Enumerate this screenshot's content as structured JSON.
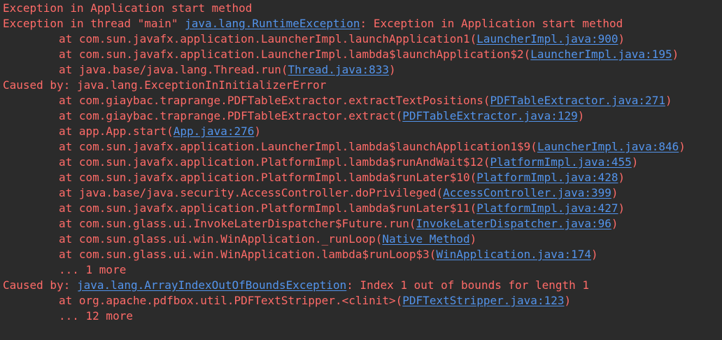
{
  "console": {
    "lines": [
      {
        "indent": false,
        "parts": [
          {
            "text": "Exception in Application start method",
            "link": false
          }
        ]
      },
      {
        "indent": false,
        "parts": [
          {
            "text": "Exception in thread \"main\" ",
            "link": false
          },
          {
            "text": "java.lang.RuntimeException",
            "link": true
          },
          {
            "text": ": Exception in Application start method",
            "link": false
          }
        ]
      },
      {
        "indent": true,
        "parts": [
          {
            "text": "at com.sun.javafx.application.LauncherImpl.launchApplication1(",
            "link": false
          },
          {
            "text": "LauncherImpl.java:900",
            "link": true
          },
          {
            "text": ")",
            "link": false
          }
        ]
      },
      {
        "indent": true,
        "parts": [
          {
            "text": "at com.sun.javafx.application.LauncherImpl.lambda$launchApplication$2(",
            "link": false
          },
          {
            "text": "LauncherImpl.java:195",
            "link": true
          },
          {
            "text": ")",
            "link": false
          }
        ]
      },
      {
        "indent": true,
        "parts": [
          {
            "text": "at java.base/java.lang.Thread.run(",
            "link": false
          },
          {
            "text": "Thread.java:833",
            "link": true
          },
          {
            "text": ")",
            "link": false
          }
        ]
      },
      {
        "indent": false,
        "parts": [
          {
            "text": "Caused by: java.lang.ExceptionInInitializerError",
            "link": false
          }
        ]
      },
      {
        "indent": true,
        "parts": [
          {
            "text": "at com.giaybac.traprange.PDFTableExtractor.extractTextPositions(",
            "link": false
          },
          {
            "text": "PDFTableExtractor.java:271",
            "link": true
          },
          {
            "text": ")",
            "link": false
          }
        ]
      },
      {
        "indent": true,
        "parts": [
          {
            "text": "at com.giaybac.traprange.PDFTableExtractor.extract(",
            "link": false
          },
          {
            "text": "PDFTableExtractor.java:129",
            "link": true
          },
          {
            "text": ")",
            "link": false
          }
        ]
      },
      {
        "indent": true,
        "parts": [
          {
            "text": "at app.App.start(",
            "link": false
          },
          {
            "text": "App.java:276",
            "link": true
          },
          {
            "text": ")",
            "link": false
          }
        ]
      },
      {
        "indent": true,
        "parts": [
          {
            "text": "at com.sun.javafx.application.LauncherImpl.lambda$launchApplication1$9(",
            "link": false
          },
          {
            "text": "LauncherImpl.java:846",
            "link": true
          },
          {
            "text": ")",
            "link": false
          }
        ]
      },
      {
        "indent": true,
        "parts": [
          {
            "text": "at com.sun.javafx.application.PlatformImpl.lambda$runAndWait$12(",
            "link": false
          },
          {
            "text": "PlatformImpl.java:455",
            "link": true
          },
          {
            "text": ")",
            "link": false
          }
        ]
      },
      {
        "indent": true,
        "parts": [
          {
            "text": "at com.sun.javafx.application.PlatformImpl.lambda$runLater$10(",
            "link": false
          },
          {
            "text": "PlatformImpl.java:428",
            "link": true
          },
          {
            "text": ")",
            "link": false
          }
        ]
      },
      {
        "indent": true,
        "parts": [
          {
            "text": "at java.base/java.security.AccessController.doPrivileged(",
            "link": false
          },
          {
            "text": "AccessController.java:399",
            "link": true
          },
          {
            "text": ")",
            "link": false
          }
        ]
      },
      {
        "indent": true,
        "parts": [
          {
            "text": "at com.sun.javafx.application.PlatformImpl.lambda$runLater$11(",
            "link": false
          },
          {
            "text": "PlatformImpl.java:427",
            "link": true
          },
          {
            "text": ")",
            "link": false
          }
        ]
      },
      {
        "indent": true,
        "parts": [
          {
            "text": "at com.sun.glass.ui.InvokeLaterDispatcher$Future.run(",
            "link": false
          },
          {
            "text": "InvokeLaterDispatcher.java:96",
            "link": true
          },
          {
            "text": ")",
            "link": false
          }
        ]
      },
      {
        "indent": true,
        "parts": [
          {
            "text": "at com.sun.glass.ui.win.WinApplication._runLoop(",
            "link": false
          },
          {
            "text": "Native Method",
            "link": true
          },
          {
            "text": ")",
            "link": false
          }
        ]
      },
      {
        "indent": true,
        "parts": [
          {
            "text": "at com.sun.glass.ui.win.WinApplication.lambda$runLoop$3(",
            "link": false
          },
          {
            "text": "WinApplication.java:174",
            "link": true
          },
          {
            "text": ")",
            "link": false
          }
        ]
      },
      {
        "indent": true,
        "parts": [
          {
            "text": "... 1 more",
            "link": false
          }
        ]
      },
      {
        "indent": false,
        "parts": [
          {
            "text": "Caused by: ",
            "link": false
          },
          {
            "text": "java.lang.ArrayIndexOutOfBoundsException",
            "link": true
          },
          {
            "text": ": Index 1 out of bounds for length 1",
            "link": false
          }
        ]
      },
      {
        "indent": true,
        "parts": [
          {
            "text": "at org.apache.pdfbox.util.PDFTextStripper.<clinit>(",
            "link": false
          },
          {
            "text": "PDFTextStripper.java:123",
            "link": true
          },
          {
            "text": ")",
            "link": false
          }
        ]
      },
      {
        "indent": true,
        "parts": [
          {
            "text": "... 12 more",
            "link": false
          }
        ]
      }
    ]
  },
  "colors": {
    "background": "#2b2b2b",
    "error_text": "#ff6b68",
    "link": "#5394ec"
  }
}
